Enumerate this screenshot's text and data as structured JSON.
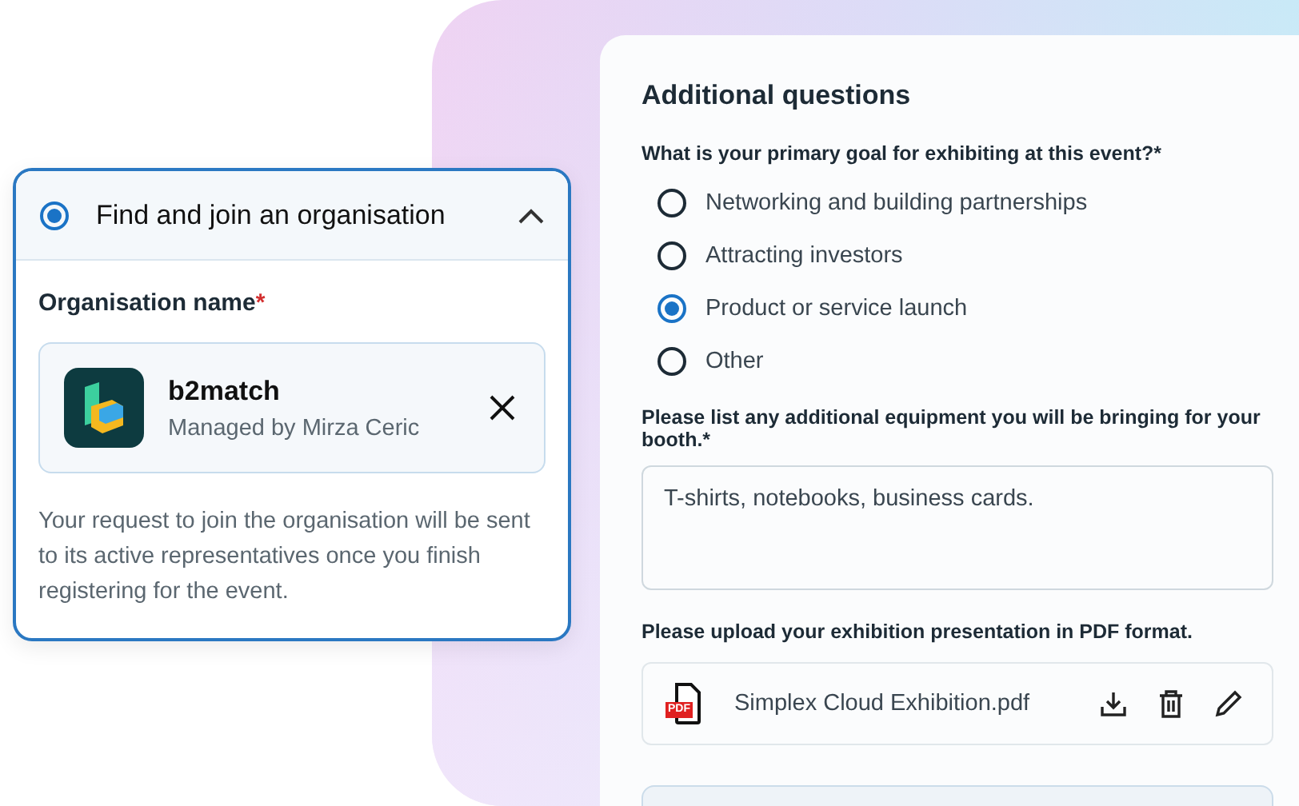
{
  "organisation_card": {
    "title": "Find and join an organisation",
    "selected": true,
    "expanded": true,
    "field_label": "Organisation name",
    "required_mark": "*",
    "organisation": {
      "name": "b2match",
      "manager": "Managed by Mirza Ceric"
    },
    "note": "Your request to join the organisation will be sent to its active representatives once you finish registering for the event."
  },
  "questions_panel": {
    "title": "Additional questions",
    "questions": [
      {
        "kind": "radio",
        "label": "What is your primary goal for exhibiting at this event?*",
        "options": [
          {
            "label": "Networking and building partnerships",
            "selected": false
          },
          {
            "label": "Attracting investors",
            "selected": false
          },
          {
            "label": "Product or service launch",
            "selected": true
          },
          {
            "label": "Other",
            "selected": false
          }
        ]
      },
      {
        "kind": "text",
        "label": "Please list any additional equipment you will be bringing for your booth.*",
        "value": "T-shirts, notebooks, business cards."
      },
      {
        "kind": "file",
        "label": "Please upload your exhibition presentation in PDF format.",
        "file_badge": "PDF",
        "file_name": "Simplex Cloud Exhibition.pdf"
      }
    ]
  }
}
